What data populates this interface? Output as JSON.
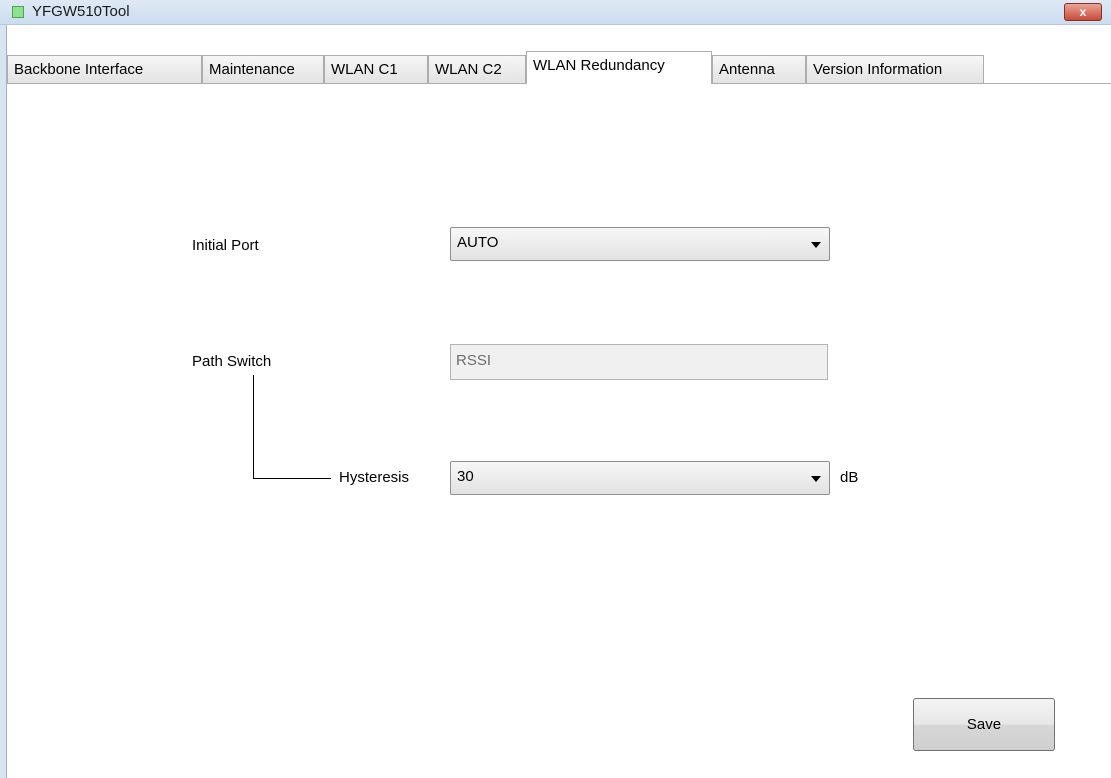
{
  "window": {
    "title": "YFGW510Tool",
    "close_label": "x"
  },
  "tabs": [
    {
      "label": "Backbone Interface",
      "active": false
    },
    {
      "label": "Maintenance",
      "active": false
    },
    {
      "label": "WLAN C1",
      "active": false
    },
    {
      "label": "WLAN C2",
      "active": false
    },
    {
      "label": "WLAN Redundancy",
      "active": true
    },
    {
      "label": "Antenna",
      "active": false
    },
    {
      "label": "Version Information",
      "active": false
    }
  ],
  "form": {
    "initial_port": {
      "label": "Initial Port",
      "value": "AUTO"
    },
    "path_switch": {
      "label": "Path Switch",
      "value": "RSSI"
    },
    "hysteresis": {
      "label": "Hysteresis",
      "value": "30",
      "unit": "dB"
    }
  },
  "actions": {
    "save_label": "Save"
  },
  "icons": {
    "app": "app-icon",
    "close": "close-icon",
    "dropdown": "chevron-down-icon"
  },
  "colors": {
    "titlebar": "#cbdcef",
    "close_button": "#c94a3a",
    "app_icon": "#8fe08f"
  }
}
